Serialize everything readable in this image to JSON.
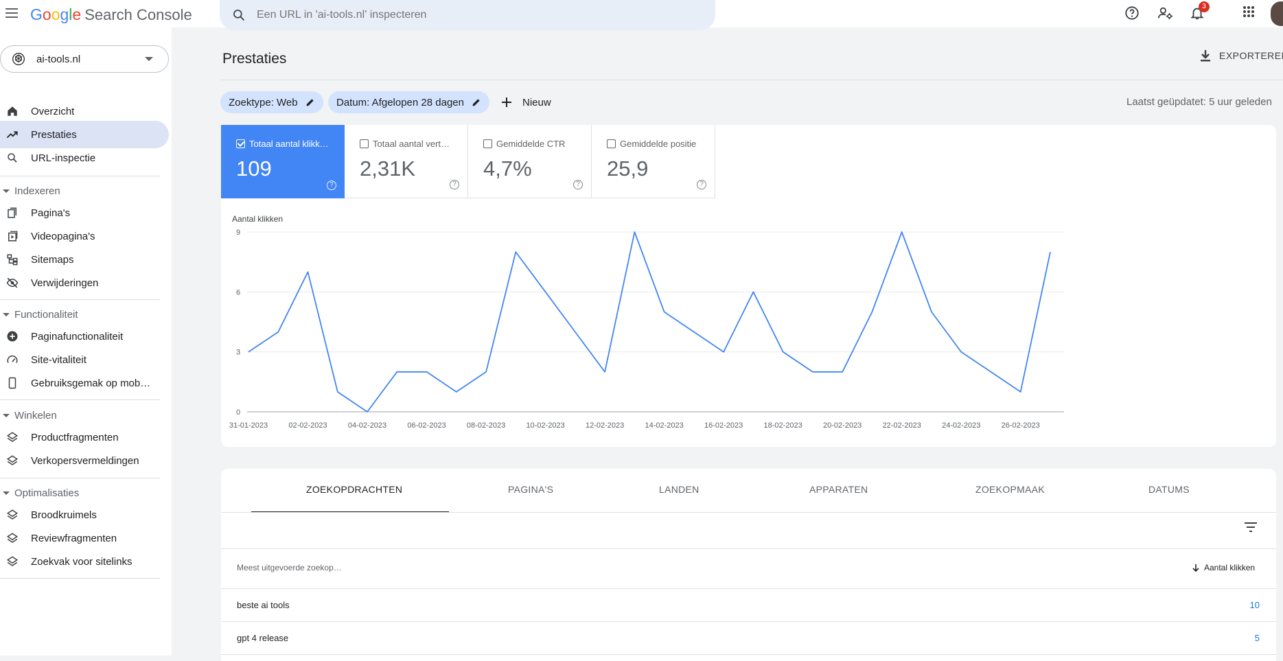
{
  "header": {
    "product": "Search Console",
    "search_placeholder": "Een URL in 'ai-tools.nl' inspecteren",
    "notification_count": "3"
  },
  "sidebar": {
    "property": "ai-tools.nl",
    "items": [
      {
        "label": "Overzicht",
        "icon": "home-icon"
      },
      {
        "label": "Prestaties",
        "icon": "trending-up-icon"
      },
      {
        "label": "URL-inspectie",
        "icon": "search-icon"
      }
    ],
    "sections": [
      {
        "title": "Indexeren",
        "items": [
          "Pagina's",
          "Videopagina's",
          "Sitemaps",
          "Verwijderingen"
        ]
      },
      {
        "title": "Functionaliteit",
        "items": [
          "Paginafunctionaliteit",
          "Site-vitaliteit",
          "Gebruiksgemak op mob…"
        ]
      },
      {
        "title": "Winkelen",
        "items": [
          "Productfragmenten",
          "Verkopersvermeldingen"
        ]
      },
      {
        "title": "Optimalisaties",
        "items": [
          "Broodkruimels",
          "Reviewfragmenten",
          "Zoekvak voor sitelinks"
        ]
      }
    ]
  },
  "main": {
    "title": "Prestaties",
    "export_label": "EXPORTEREN",
    "chips": [
      "Zoektype: Web",
      "Datum: Afgelopen 28 dagen"
    ],
    "new_label": "Nieuw",
    "last_updated": "Laatst geüpdatet: 5 uur geleden"
  },
  "metrics": [
    {
      "label": "Totaal aantal klikk…",
      "value": "109",
      "selected": true
    },
    {
      "label": "Totaal aantal vert…",
      "value": "2,31K",
      "selected": false
    },
    {
      "label": "Gemiddelde CTR",
      "value": "4,7%",
      "selected": false
    },
    {
      "label": "Gemiddelde positie",
      "value": "25,9",
      "selected": false
    }
  ],
  "chart_data": {
    "type": "line",
    "ylabel": "Aantal klikken",
    "ylim": [
      0,
      9
    ],
    "yticks": [
      0,
      3,
      6,
      9
    ],
    "xtick_labels": [
      "31-01-2023",
      "02-02-2023",
      "04-02-2023",
      "06-02-2023",
      "08-02-2023",
      "10-02-2023",
      "12-02-2023",
      "14-02-2023",
      "16-02-2023",
      "18-02-2023",
      "20-02-2023",
      "22-02-2023",
      "24-02-2023",
      "26-02-2023"
    ],
    "series": [
      {
        "color": "#4285f4",
        "values": [
          3,
          4,
          7,
          1,
          0,
          2,
          2,
          1,
          2,
          8,
          6,
          4,
          2,
          9,
          5,
          4,
          3,
          6,
          3,
          2,
          2,
          5,
          9,
          5,
          3,
          2,
          1,
          8
        ]
      }
    ],
    "grid": true
  },
  "table": {
    "tabs": [
      "ZOEKOPDRACHTEN",
      "PAGINA'S",
      "LANDEN",
      "APPARATEN",
      "ZOEKOPMAAK",
      "DATUMS"
    ],
    "col_query": "Meest uitgevoerde zoekop…",
    "col_clicks": "Aantal klikken",
    "rows": [
      {
        "query": "beste ai tools",
        "clicks": "10"
      },
      {
        "query": "gpt 4 release",
        "clicks": "5"
      }
    ]
  },
  "colors": {
    "accent": "#4285f4",
    "active_nav": "#dbe3f5"
  }
}
